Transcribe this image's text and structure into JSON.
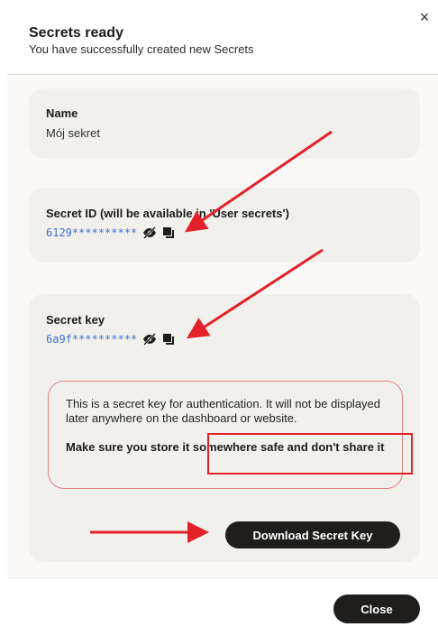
{
  "header": {
    "title": "Secrets ready",
    "subtitle": "You have successfully created new Secrets",
    "close_glyph": "×"
  },
  "name_card": {
    "label": "Name",
    "value": "Mój sekret"
  },
  "id_card": {
    "label": "Secret ID (will be available in 'User secrets')",
    "masked_value": "6129**********",
    "icons": [
      "eye-off-icon",
      "copy-icon"
    ]
  },
  "key_card": {
    "label": "Secret key",
    "masked_value": "6a9f**********",
    "icons": [
      "eye-off-icon",
      "copy-icon"
    ],
    "warning_text": "This is a secret key for authentication. It will not be displayed later anywhere on the dashboard or website.",
    "warning_strong": "Make sure you store it somewhere safe and don't share it",
    "download_label": "Download Secret Key"
  },
  "footer": {
    "close_label": "Close"
  },
  "colors": {
    "accent_dark": "#1f1e1c",
    "masked_text": "#3d6fd9",
    "warning_border": "#e08282",
    "annotation_red": "#e3212a",
    "card_bg": "#f2f0ec"
  }
}
